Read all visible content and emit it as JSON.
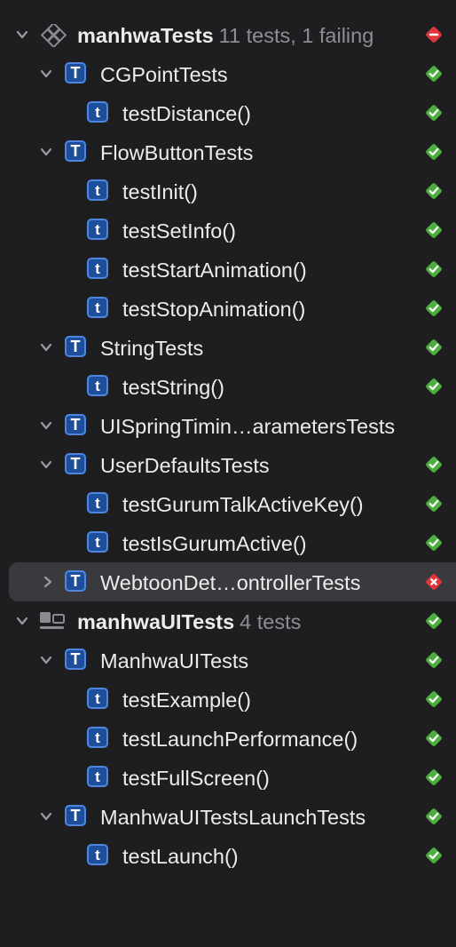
{
  "colors": {
    "pass": "#4cae3e",
    "fail": "#e0353a",
    "icon_blue": "#1d4e99",
    "icon_border": "#4f86e0",
    "background": "#1e1e21",
    "selected_row": "#3a3a3e",
    "meta_text": "#8d8d92"
  },
  "icons": {
    "expanded": "chevron-down-icon",
    "collapsed": "chevron-right-icon",
    "unit_bundle": "test-bundle-icon",
    "ui_bundle": "ui-test-bundle-icon",
    "class_glyph": "T",
    "method_glyph": "t",
    "pass": "checkmark-diamond-icon",
    "fail": "x-diamond-icon"
  },
  "tree": {
    "bundle1": {
      "name": "manhwaTests",
      "meta": "11 tests, 1 failing",
      "status": "fail",
      "classes": {
        "cgpoint": {
          "name": "CGPointTests",
          "status": "pass",
          "methods": [
            "testDistance()"
          ]
        },
        "flowbutton": {
          "name": "FlowButtonTests",
          "status": "pass",
          "methods": [
            "testInit()",
            "testSetInfo()",
            "testStartAnimation()",
            "testStopAnimation()"
          ]
        },
        "string": {
          "name": "StringTests",
          "status": "pass",
          "methods": [
            "testString()"
          ]
        },
        "uispring": {
          "name": "UISpringTimin…arametersTests",
          "status": "none"
        },
        "userdefaults": {
          "name": "UserDefaultsTests",
          "status": "pass",
          "methods": [
            "testGurumTalkActiveKey()",
            "testIsGurumActive()"
          ]
        },
        "webtoon": {
          "name": "WebtoonDet…ontrollerTests",
          "status": "fail",
          "collapsed": true,
          "selected": true
        }
      }
    },
    "bundle2": {
      "name": "manhwaUITests",
      "meta": "4 tests",
      "status": "pass",
      "classes": {
        "manhwauitests": {
          "name": "ManhwaUITests",
          "status": "pass",
          "methods": [
            "testExample()",
            "testLaunchPerformance()",
            "testFullScreen()"
          ]
        },
        "launchtests": {
          "name": "ManhwaUITestsLaunchTests",
          "status": "pass",
          "methods": [
            "testLaunch()"
          ]
        }
      }
    }
  }
}
